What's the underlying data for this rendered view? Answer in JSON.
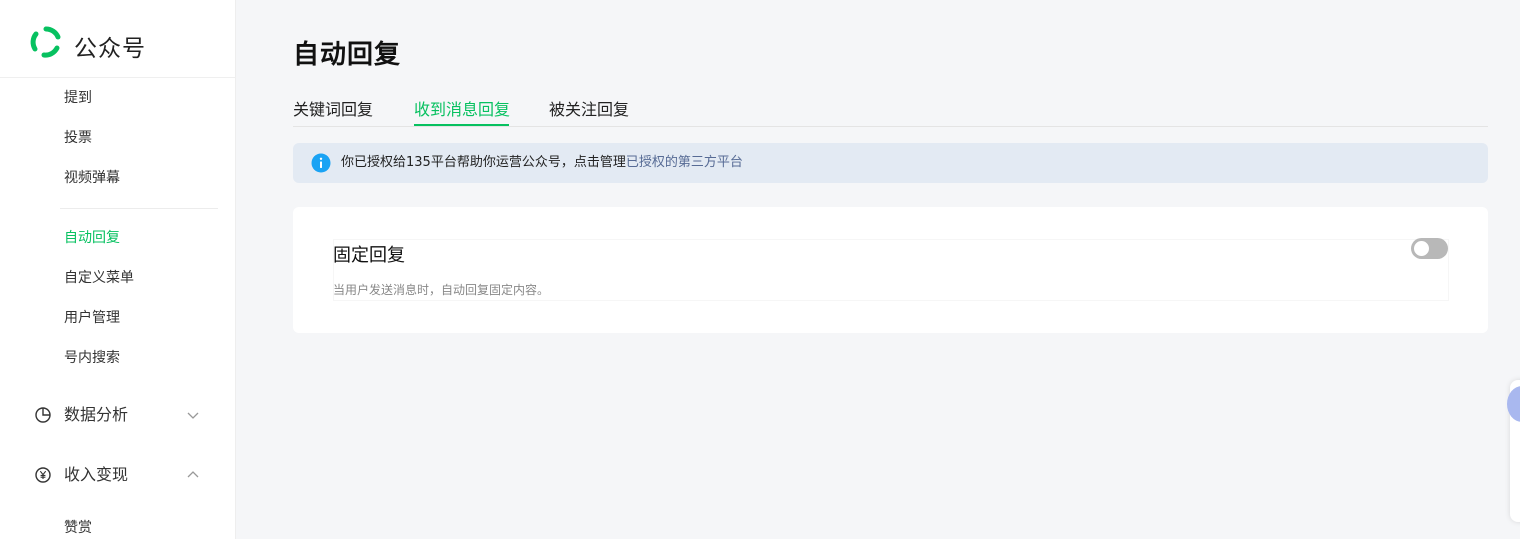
{
  "brand": {
    "name": "公众号",
    "logo_icon": "wechat-official-account-logo",
    "color": "#07c160"
  },
  "sidebar": {
    "items_top": [
      {
        "label": "提到"
      },
      {
        "label": "投票"
      },
      {
        "label": "视频弹幕"
      }
    ],
    "items_mid": [
      {
        "label": "自动回复",
        "active": true
      },
      {
        "label": "自定义菜单"
      },
      {
        "label": "用户管理"
      },
      {
        "label": "号内搜索"
      }
    ],
    "groups": [
      {
        "label": "数据分析",
        "icon": "pie-chart-icon",
        "expanded": false
      },
      {
        "label": "收入变现",
        "icon": "yen-icon",
        "expanded": true
      }
    ],
    "items_bottom": [
      {
        "label": "赞赏"
      }
    ]
  },
  "page": {
    "title": "自动回复"
  },
  "tabs": [
    {
      "label": "关键词回复"
    },
    {
      "label": "收到消息回复",
      "active": true
    },
    {
      "label": "被关注回复"
    }
  ],
  "notice": {
    "text": "你已授权给135平台帮助你运营公众号，点击管理",
    "link": "已授权的第三方平台"
  },
  "card": {
    "title": "固定回复",
    "description": "当用户发送消息时，自动回复固定内容。",
    "toggle_on": false
  },
  "colors": {
    "accent": "#07c160",
    "link": "#576b95",
    "notice_bg": "#e3eaf3",
    "info": "#1aa3f4"
  }
}
